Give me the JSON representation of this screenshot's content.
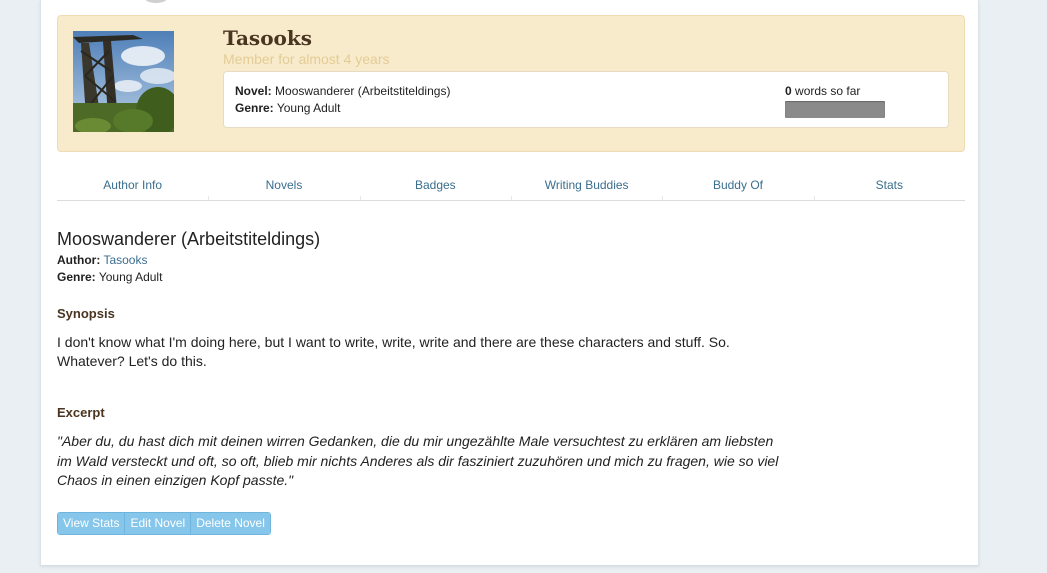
{
  "profile": {
    "username": "Tasooks",
    "member_since": "Member for almost 4 years",
    "novel_label": "Novel:",
    "novel_value": "Mooswanderer (Arbeitstiteldings)",
    "genre_label": "Genre:",
    "genre_value": "Young Adult",
    "word_count": "0",
    "word_count_suffix": " words so far",
    "progress_fraction": 0
  },
  "tabs": [
    {
      "label": "Author Info"
    },
    {
      "label": "Novels"
    },
    {
      "label": "Badges"
    },
    {
      "label": "Writing Buddies"
    },
    {
      "label": "Buddy Of"
    },
    {
      "label": "Stats"
    }
  ],
  "novel": {
    "title": "Mooswanderer (Arbeitstiteldings)",
    "author_label": "Author:",
    "author_value": "Tasooks",
    "genre_label": "Genre:",
    "genre_value": "Young Adult",
    "synopsis_heading": "Synopsis",
    "synopsis": "I don't know what I'm doing here, but I want to write, write, write and there are these characters and stuff. So. Whatever? Let's do this.",
    "excerpt_heading": "Excerpt",
    "excerpt": "\"Aber du, du hast dich mit deinen wirren Gedanken, die du mir ungezählte Male versuchtest zu erklären am liebsten im Wald versteckt und oft, so oft, blieb mir nichts Anderes als dir fasziniert zuzuhören und mich zu fragen, wie so viel Chaos in einen einzigen Kopf passte.\""
  },
  "actions": {
    "view_stats": "View Stats",
    "edit_novel": "Edit Novel",
    "delete_novel": "Delete Novel"
  },
  "colors": {
    "card_background": "#f8ebcc",
    "link": "#3a6e8e",
    "button": "#86c6ea",
    "heading_brown": "#4a3520"
  },
  "icons": {
    "avatar": "avatar-photo"
  }
}
